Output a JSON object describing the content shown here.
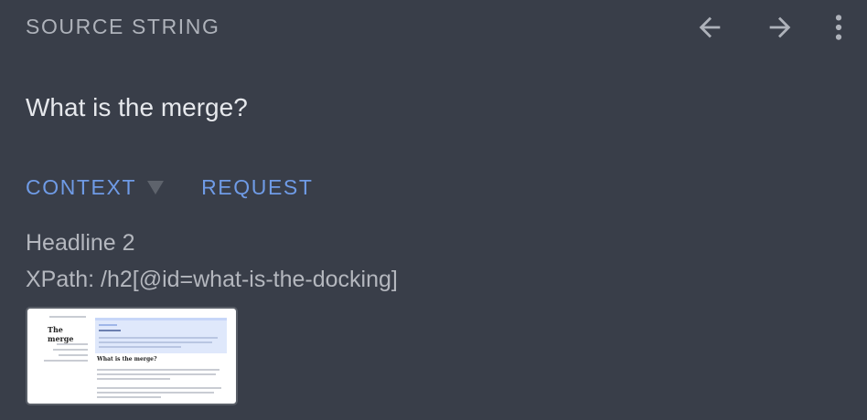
{
  "header": {
    "title": "SOURCE STRING"
  },
  "toolbar": {
    "back_icon": "arrow-left-icon",
    "forward_icon": "arrow-right-icon",
    "more_icon": "more-vert-icon"
  },
  "source": {
    "text": "What is the merge?"
  },
  "tabs": [
    {
      "label": "CONTEXT",
      "active": true,
      "has_dropdown": true
    },
    {
      "label": "REQUEST",
      "active": false,
      "has_dropdown": false
    }
  ],
  "context": {
    "line1": "Headline 2",
    "line2": "XPath: /h2[@id=what-is-the-docking]"
  },
  "screenshot_thumbnail": {
    "left_heading": "The merge",
    "right_heading": "What is the merge?"
  },
  "colors": {
    "background": "#393e49",
    "accent": "#6f9be6",
    "muted_text": "#aeb2ba",
    "primary_text": "#e6e8ec"
  }
}
